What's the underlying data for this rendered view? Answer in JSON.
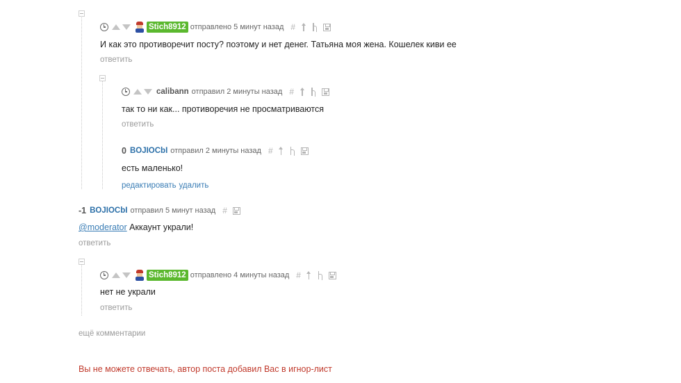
{
  "comments": [
    {
      "user": "Stich8912",
      "meta": "отправлено 5 минут назад",
      "text": "И как это противоречит посту? поэтому и нет денег. Татьяна моя жена. Кошелек киви ее",
      "reply": "ответить"
    },
    {
      "user": "calibann",
      "meta": "отправил 2 минуты назад",
      "text": "так то ни как... противоречия не просматриваются",
      "reply": "ответить"
    },
    {
      "score": "0",
      "user": "BOJIOCbI",
      "meta": "отправил 2 минуты назад",
      "text": "есть маленько!",
      "edit": "редактировать",
      "delete": "удалить"
    },
    {
      "score": "-1",
      "user": "BOJIOCbI",
      "meta": "отправил 5 минут назад",
      "mention": "@moderator",
      "text": " Аккаунт украли!",
      "reply": "ответить"
    },
    {
      "user": "Stich8912",
      "meta": "отправлено 4 минуты назад",
      "text": "нет не украли",
      "reply": "ответить"
    }
  ],
  "tools": {
    "hash": "#"
  },
  "more_comments": "ещё комментарии",
  "ignore_notice": "Вы не можете отвечать, автор поста добавил Вас в игнор-лист",
  "colors": {
    "user_badge": "#5bb82e",
    "link": "#3a7db5",
    "notice": "#c0392b"
  }
}
